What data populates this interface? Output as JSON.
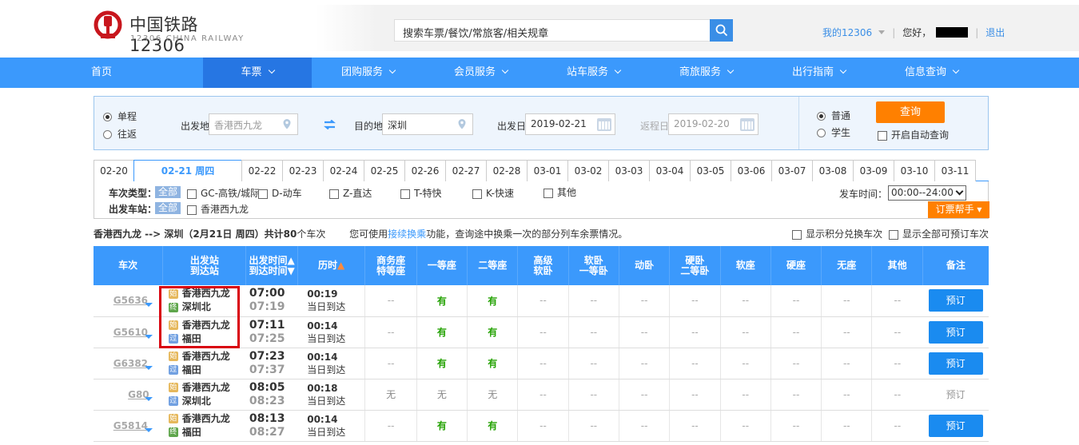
{
  "header": {
    "logo_cn": "中国铁路12306",
    "logo_en": "12306 CHINA RAILWAY",
    "search_placeholder": "搜索车票/餐饮/常旅客/相关规章",
    "my12306": "我的12306",
    "hello": "您好，",
    "logout": "退出"
  },
  "nav": {
    "items": [
      {
        "label": "首页"
      },
      {
        "label": "车票"
      },
      {
        "label": "团购服务"
      },
      {
        "label": "会员服务"
      },
      {
        "label": "站车服务"
      },
      {
        "label": "商旅服务"
      },
      {
        "label": "出行指南"
      },
      {
        "label": "信息查询"
      }
    ]
  },
  "query": {
    "one_way": "单程",
    "round_trip": "往返",
    "from_label": "出发地",
    "from_value": "香港西九龙",
    "to_label": "目的地",
    "to_value": "深圳",
    "date_label": "出发日",
    "date_value": "2019-02-21",
    "return_label": "返程日",
    "return_value": "2019-02-20",
    "normal": "普通",
    "student": "学生",
    "search_btn": "查询",
    "auto_query": "开启自动查询"
  },
  "dates": [
    "02-20",
    "02-21 周四",
    "02-22",
    "02-23",
    "02-24",
    "02-25",
    "02-26",
    "02-27",
    "02-28",
    "03-01",
    "03-02",
    "03-03",
    "03-04",
    "03-05",
    "03-06",
    "03-07",
    "03-08",
    "03-09",
    "03-10",
    "03-11"
  ],
  "filter": {
    "type_label": "车次类型：",
    "all": "全部",
    "types": [
      "GC-高铁/城际",
      "D-动车",
      "Z-直达",
      "T-特快",
      "K-快速",
      "其他"
    ],
    "station_label": "出发车站：",
    "station_all": "全部",
    "station": "香港西九龙",
    "time_label": "发车时间：",
    "time_value": "00:00--24:00",
    "help": "订票帮手"
  },
  "summary": {
    "route": "香港西九龙 --> 深圳（2月21日  周四）共计",
    "count": "80",
    "count_suffix": "个车次",
    "tip_pre": "您可使用",
    "tip_link": "接续换乘",
    "tip_post": "功能，查询途中换乘一次的部分列车余票情况。",
    "opt1": "显示积分兑换车次",
    "opt2": "显示全部可预订车次"
  },
  "table": {
    "headers": {
      "train": "车次",
      "station1": "出发站",
      "station2": "到达站",
      "time1": "出发时间",
      "time2": "到达时间",
      "duration": "历时",
      "biz1": "商务座",
      "biz2": "特等座",
      "first": "一等座",
      "second": "二等座",
      "adv1": "高级",
      "adv2": "软卧",
      "soft1": "软卧",
      "soft2": "一等卧",
      "move": "动卧",
      "hard1": "硬卧",
      "hard2": "二等卧",
      "softseat": "软座",
      "hardseat": "硬座",
      "noseat": "无座",
      "other": "其他",
      "remark": "备注"
    },
    "rows": [
      {
        "train": "G5636",
        "from": "香港西九龙",
        "to": "深圳北",
        "dep": "07:00",
        "arr": "07:19",
        "dur": "00:19",
        "day": "当日到达",
        "biz": "--",
        "first": "有",
        "second": "有",
        "adv": "--",
        "soft": "--",
        "move": "--",
        "hard": "--",
        "softseat": "--",
        "hardseat": "--",
        "noseat": "--",
        "other": "--",
        "book": "预订",
        "to_badge": "终",
        "bookable": true
      },
      {
        "train": "G5610",
        "from": "香港西九龙",
        "to": "福田",
        "dep": "07:11",
        "arr": "07:25",
        "dur": "00:14",
        "day": "当日到达",
        "biz": "--",
        "first": "有",
        "second": "有",
        "adv": "--",
        "soft": "--",
        "move": "--",
        "hard": "--",
        "softseat": "--",
        "hardseat": "--",
        "noseat": "--",
        "other": "--",
        "book": "预订",
        "to_badge": "过",
        "bookable": true
      },
      {
        "train": "G6382",
        "from": "香港西九龙",
        "to": "福田",
        "dep": "07:23",
        "arr": "07:37",
        "dur": "00:14",
        "day": "当日到达",
        "biz": "--",
        "first": "有",
        "second": "有",
        "adv": "--",
        "soft": "--",
        "move": "--",
        "hard": "--",
        "softseat": "--",
        "hardseat": "--",
        "noseat": "--",
        "other": "--",
        "book": "预订",
        "to_badge": "过",
        "bookable": true
      },
      {
        "train": "G80",
        "from": "香港西九龙",
        "to": "深圳北",
        "dep": "08:05",
        "arr": "08:23",
        "dur": "00:18",
        "day": "当日到达",
        "biz": "无",
        "first": "无",
        "second": "无",
        "adv": "--",
        "soft": "--",
        "move": "--",
        "hard": "--",
        "softseat": "--",
        "hardseat": "--",
        "noseat": "--",
        "other": "--",
        "book": "预订",
        "to_badge": "过",
        "bookable": false
      },
      {
        "train": "G5814",
        "from": "香港西九龙",
        "to": "福田",
        "dep": "08:13",
        "arr": "08:27",
        "dur": "00:14",
        "day": "当日到达",
        "biz": "--",
        "first": "有",
        "second": "有",
        "adv": "--",
        "soft": "--",
        "move": "--",
        "hard": "--",
        "softseat": "--",
        "hardseat": "--",
        "noseat": "--",
        "other": "--",
        "book": "预订",
        "to_badge": "终",
        "bookable": true
      }
    ],
    "start_badge": "始"
  }
}
